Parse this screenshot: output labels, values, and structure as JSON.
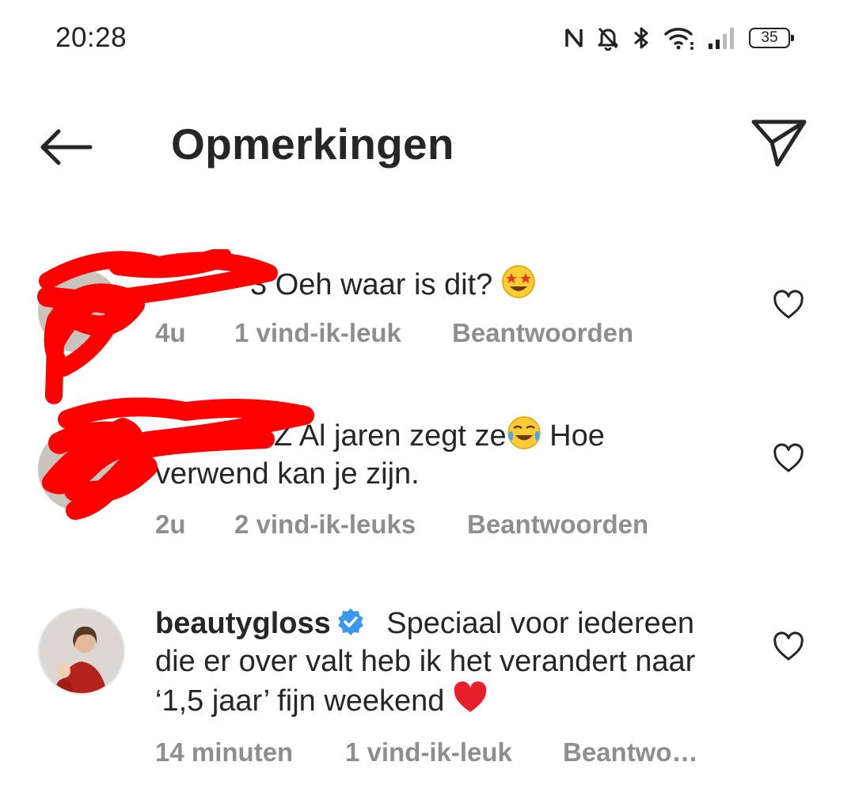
{
  "status_bar": {
    "time": "20:28",
    "battery": "35",
    "icons": [
      "nfc-icon",
      "mute-bell-icon",
      "bluetooth-icon",
      "wifi-icon",
      "signal-icon",
      "battery-icon"
    ]
  },
  "header": {
    "title": "Opmerkingen",
    "back_icon": "back-arrow-icon",
    "share_icon": "paper-plane-icon"
  },
  "comments": [
    {
      "username_visible": "3",
      "text": "Oeh waar is dit?",
      "emoji": "star-struck-emoji",
      "time": "4u",
      "likes": "1 vind-ik-leuk",
      "reply": "Beantwoorden",
      "redacted": true
    },
    {
      "username_visible": "Z",
      "text_line1": "Al jaren zegt ze",
      "emoji": "tears-of-joy-emoji",
      "text_line1_end": "Hoe",
      "text_line2": "verwend kan je zijn.",
      "time": "2u",
      "likes": "2 vind-ik-leuks",
      "reply": "Beantwoorden",
      "redacted": true
    },
    {
      "username": "beautygloss",
      "verified": true,
      "text_line1": "Speciaal voor iedereen",
      "text_line2": "die er over valt heb ik het verandert naar",
      "text_line3": "‘1,5 jaar’ fijn weekend",
      "emoji": "red-heart-emoji",
      "time": "14 minuten",
      "likes": "1 vind-ik-leuk",
      "reply": "Beantwo…",
      "redacted": false
    }
  ],
  "colors": {
    "text": "#262626",
    "meta": "#8e8e8e",
    "verified": "#3897f0",
    "redaction": "#ff0000"
  }
}
